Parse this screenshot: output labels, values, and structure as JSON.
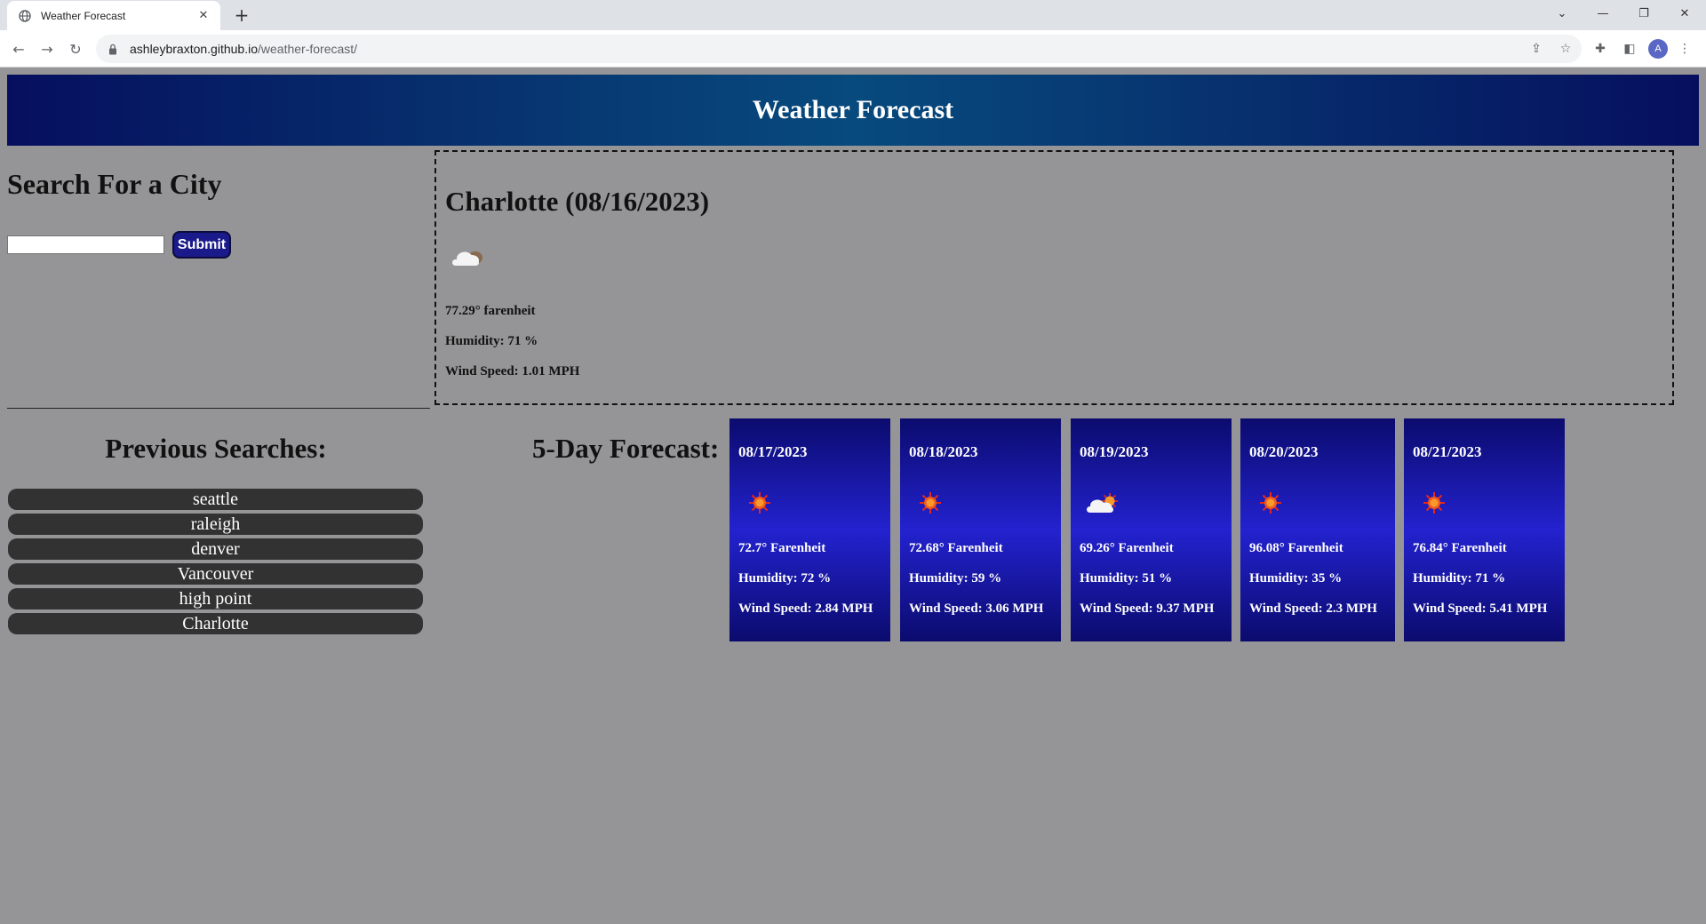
{
  "browser": {
    "tab_title": "Weather Forecast",
    "url_host": "ashleybraxton.github.io",
    "url_path": "/weather-forecast/",
    "avatar_letter": "A"
  },
  "header": {
    "title": "Weather Forecast"
  },
  "search": {
    "title": "Search For a City",
    "input_value": "",
    "submit_label": "Submit"
  },
  "current": {
    "title": "Charlotte (08/16/2023)",
    "icon": "clouds-icon",
    "temp": "77.29° farenheit",
    "humidity": "Humidity: 71 %",
    "wind": "Wind Speed: 1.01 MPH"
  },
  "previous": {
    "title": "Previous Searches:",
    "items": [
      "seattle",
      "raleigh",
      "denver",
      "Vancouver",
      "high point",
      "Charlotte"
    ]
  },
  "forecast": {
    "title": "5-Day Forecast:",
    "days": [
      {
        "date": "08/17/2023",
        "icon": "sun-icon",
        "temp": "72.7° Farenheit",
        "humidity": "Humidity: 72 %",
        "wind": "Wind Speed: 2.84 MPH"
      },
      {
        "date": "08/18/2023",
        "icon": "sun-icon",
        "temp": "72.68° Farenheit",
        "humidity": "Humidity: 59 %",
        "wind": "Wind Speed: 3.06 MPH"
      },
      {
        "date": "08/19/2023",
        "icon": "sun-cloud-icon",
        "temp": "69.26° Farenheit",
        "humidity": "Humidity: 51 %",
        "wind": "Wind Speed: 9.37 MPH"
      },
      {
        "date": "08/20/2023",
        "icon": "sun-icon",
        "temp": "96.08° Farenheit",
        "humidity": "Humidity: 35 %",
        "wind": "Wind Speed: 2.3 MPH"
      },
      {
        "date": "08/21/2023",
        "icon": "sun-icon",
        "temp": "76.84° Farenheit",
        "humidity": "Humidity: 71 %",
        "wind": "Wind Speed: 5.41 MPH"
      }
    ]
  },
  "colors": {
    "page_bg": "#959597",
    "header_dark": "#060f5e",
    "header_mid": "#074a7d",
    "card_dark": "#0b0b6e",
    "card_mid": "#2322cf",
    "pill_bg": "#323232",
    "submit_bg": "#1a1a8a"
  }
}
